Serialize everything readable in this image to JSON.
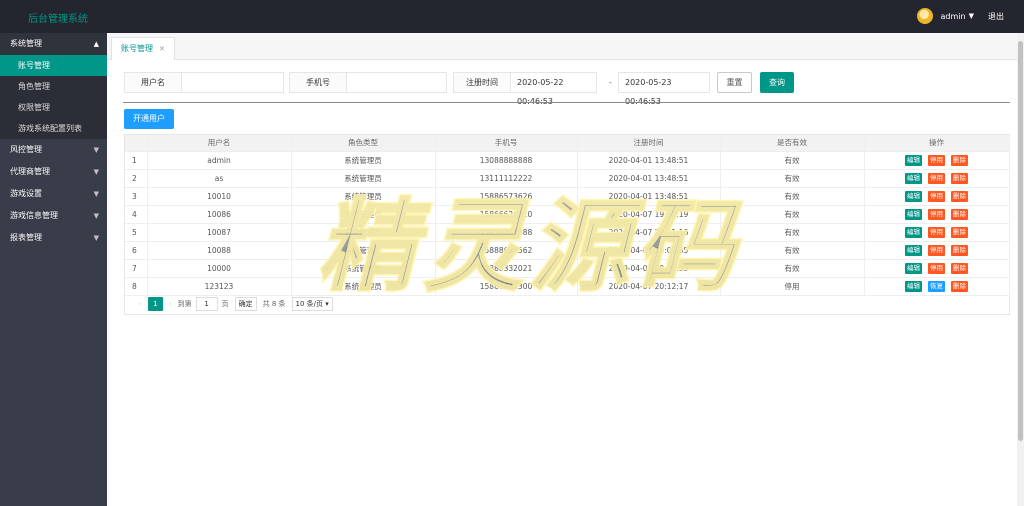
{
  "header": {
    "brand": "后台管理系统",
    "user": "admin",
    "logout": "退出"
  },
  "sidebar": {
    "groups": [
      {
        "label": "系统管理",
        "items": [
          "账号管理",
          "角色管理",
          "权限管理",
          "游戏系统配置列表"
        ]
      },
      {
        "label": "风控管理"
      },
      {
        "label": "代理商管理"
      },
      {
        "label": "游戏设置"
      },
      {
        "label": "游戏信息管理"
      },
      {
        "label": "报表管理"
      }
    ]
  },
  "tabs": [
    {
      "label": "账号管理"
    }
  ],
  "filters": {
    "username_label": "用户名",
    "username_value": "",
    "phone_label": "手机号",
    "phone_value": "",
    "regtime_label": "注册时间",
    "date_from": "2020-05-22 00:46:53",
    "date_sep": "-",
    "date_to": "2020-05-23 00:46:53",
    "reset": "重置",
    "query": "查询"
  },
  "open_user_button": "开通用户",
  "table": {
    "columns": [
      "",
      "用户名",
      "角色类型",
      "手机号",
      "注册时间",
      "是否有效",
      "操作"
    ],
    "rows": [
      {
        "idx": "1",
        "username": "admin",
        "role": "系统管理员",
        "phone": "13088888888",
        "regtime": "2020-04-01 13:48:51",
        "valid": "有效",
        "toggle": "停用"
      },
      {
        "idx": "2",
        "username": "as",
        "role": "系统管理员",
        "phone": "13111112222",
        "regtime": "2020-04-01 13:48:51",
        "valid": "有效",
        "toggle": "停用"
      },
      {
        "idx": "3",
        "username": "10010",
        "role": "系统管理员",
        "phone": "15886573626",
        "regtime": "2020-04-01 13:48:51",
        "valid": "有效",
        "toggle": "停用"
      },
      {
        "idx": "4",
        "username": "10086",
        "role": "系统管理员",
        "phone": "15866626320",
        "regtime": "2020-04-07 19:57:19",
        "valid": "有效",
        "toggle": "停用"
      },
      {
        "idx": "5",
        "username": "10087",
        "role": "系统管理员",
        "phone": "13255558888",
        "regtime": "2020-04-07 20:01:16",
        "valid": "有效",
        "toggle": "停用"
      },
      {
        "idx": "6",
        "username": "10088",
        "role": "系统管理员",
        "phone": "15888664562",
        "regtime": "2020-04-07 20:02:35",
        "valid": "有效",
        "toggle": "停用"
      },
      {
        "idx": "7",
        "username": "10000",
        "role": "系统管理员",
        "phone": "15888332021",
        "regtime": "2020-04-07 20:06:33",
        "valid": "有效",
        "toggle": "停用"
      },
      {
        "idx": "8",
        "username": "123123",
        "role": "系统管理员",
        "phone": "15866633300",
        "regtime": "2020-04-07 20:12:17",
        "valid": "停用",
        "toggle": "恢复"
      }
    ],
    "op_edit": "编辑",
    "op_delete": "删除"
  },
  "pager": {
    "current": "1",
    "goto_label": "到第",
    "goto_value": "1",
    "page_unit": "页",
    "confirm": "确定",
    "total": "共 8 条",
    "page_size": "10 条/页"
  },
  "watermark": "精灵源码",
  "colors": {
    "primary": "#009688",
    "danger": "#ff5722",
    "info": "#1e9fff",
    "sidebar": "#393d49",
    "topbar": "#23262e"
  }
}
